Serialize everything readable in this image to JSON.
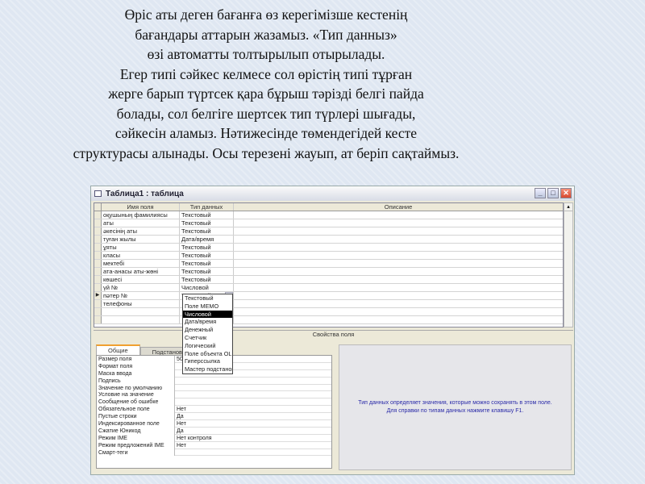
{
  "caption": [
    "Өріс аты деген  бағанға өз керегімізше кестенің",
    "бағандары аттарын  жазамыз. «Тип данныз»",
    "өзі автоматты толтырылып отырылады.",
    "Егер типі сәйкес келмесе  сол өрістің типі тұрған",
    "жерге барып түртсек қара бұрыш тәрізді белгі пайда",
    "болады, сол белгіге шертсек тип түрлері шығады,",
    "сәйкесін аламыз. Нәтижесінде  төмендегідей кесте",
    "структурасы алынады. Осы терезені жауып, ат беріп сақтаймыз."
  ],
  "window": {
    "title": "Таблица1 : таблица",
    "min": "_",
    "max": "□",
    "close": "✕"
  },
  "grid": {
    "headers": [
      "Имя поля",
      "Тип данных",
      "Описание"
    ],
    "rows": [
      [
        "оқушының фамилиясы",
        "Текстовый"
      ],
      [
        "аты",
        "Текстовый"
      ],
      [
        "әкесінің аты",
        "Текстовый"
      ],
      [
        "туған жылы",
        "Дата/время"
      ],
      [
        "ұяты",
        "Текстовый"
      ],
      [
        "класы",
        "Текстовый"
      ],
      [
        "мектебі",
        "Текстовый"
      ],
      [
        "ата-анасы аты-жөні",
        "Текстовый"
      ],
      [
        "көшесі",
        "Текстовый"
      ],
      [
        "үй №",
        "Числовой"
      ],
      [
        "пәтер №",
        "Текстовый"
      ],
      [
        "телефоны",
        ""
      ]
    ],
    "current_row_marker": "▶",
    "dropdown_arrow": "▾"
  },
  "dropdown": {
    "options": [
      "Текстовый",
      "Поле MEMO",
      "Числовой",
      "Дата/время",
      "Денежный",
      "Счетчик",
      "Логический",
      "Поле объекта OLE",
      "Гиперссылка",
      "Мастер подстановок"
    ],
    "highlighted": 2
  },
  "properties": {
    "title": "Свойства поля",
    "tabs": [
      "Общие",
      "Подстановка"
    ],
    "rows": [
      [
        "Размер поля",
        "50"
      ],
      [
        "Формат поля",
        ""
      ],
      [
        "Маска ввода",
        ""
      ],
      [
        "Подпись",
        ""
      ],
      [
        "Значение по умолчанию",
        ""
      ],
      [
        "Условие на значение",
        ""
      ],
      [
        "Сообщение об ошибке",
        ""
      ],
      [
        "Обязательное поле",
        "Нет"
      ],
      [
        "Пустые строки",
        "Да"
      ],
      [
        "Индексированное поле",
        "Нет"
      ],
      [
        "Сжатие Юникод",
        "Да"
      ],
      [
        "Режим IME",
        "Нет контроля"
      ],
      [
        "Режим предложений IME",
        "Нет"
      ],
      [
        "Смарт-теги",
        ""
      ]
    ]
  },
  "help": {
    "line1": "Тип данных определяет значения, которые можно сохранять в этом поле.",
    "line2": "Для справки по типам данных нажмите клавишу F1."
  }
}
